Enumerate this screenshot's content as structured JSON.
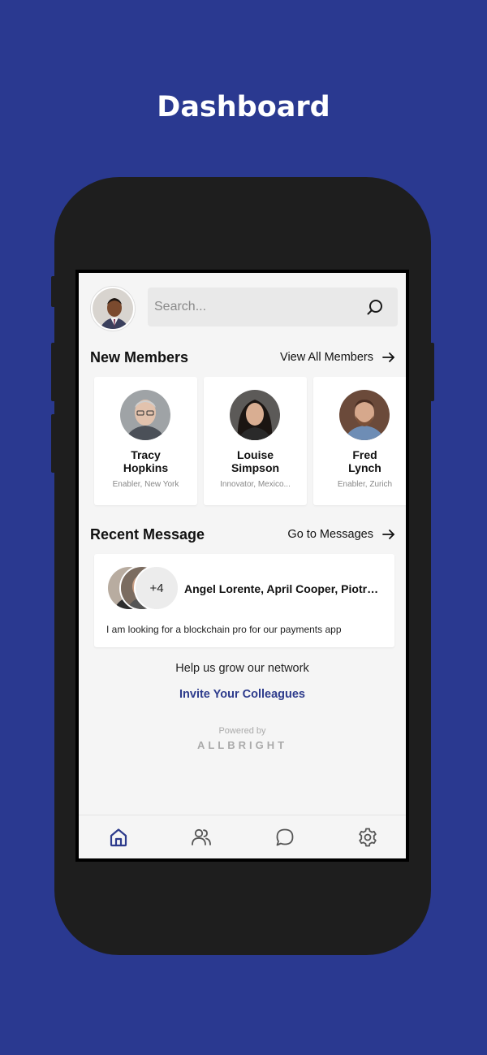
{
  "page_title": "Dashboard",
  "search": {
    "placeholder": "Search..."
  },
  "new_members": {
    "title": "New Members",
    "link_label": "View All Members",
    "items": [
      {
        "first": "Tracy",
        "last": "Hopkins",
        "subtitle": "Enabler, New York"
      },
      {
        "first": "Louise",
        "last": "Simpson",
        "subtitle": "Innovator, Mexico..."
      },
      {
        "first": "Fred",
        "last": "Lynch",
        "subtitle": "Enabler, Zurich"
      }
    ]
  },
  "recent_message": {
    "title": "Recent Message",
    "link_label": "Go to Messages",
    "extra_count": "+4",
    "participants": "Angel Lorente, April Cooper, Piotr ...",
    "text": "I am looking for a blockchain pro for our payments app"
  },
  "network": {
    "prompt": "Help us grow our network",
    "invite_label": "Invite Your Colleagues",
    "powered_by": "Powered by",
    "brand": "ALLBRIGHT"
  },
  "colors": {
    "background": "#2a3990",
    "accent": "#2d3b8c",
    "phone_body": "#1e1e1e"
  },
  "nav": [
    {
      "name": "home-icon",
      "active": true
    },
    {
      "name": "members-icon",
      "active": false
    },
    {
      "name": "messages-icon",
      "active": false
    },
    {
      "name": "settings-icon",
      "active": false
    }
  ]
}
